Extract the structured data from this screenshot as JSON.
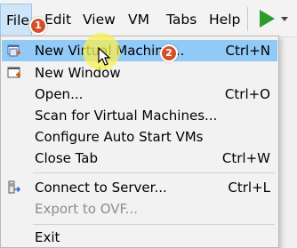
{
  "menubar": {
    "items": [
      "File",
      "Edit",
      "View",
      "VM",
      "Tabs",
      "Help"
    ]
  },
  "file_menu": {
    "new_vm": {
      "label": "New Virtual Machine...",
      "shortcut": "Ctrl+N"
    },
    "new_window": {
      "label": "New Window"
    },
    "open": {
      "label": "Open...",
      "shortcut": "Ctrl+O"
    },
    "scan": {
      "label": "Scan for Virtual Machines..."
    },
    "configure_autostart": {
      "label": "Configure Auto Start VMs"
    },
    "close_tab": {
      "label": "Close Tab",
      "shortcut": "Ctrl+W"
    },
    "connect_server": {
      "label": "Connect to Server...",
      "shortcut": "Ctrl+L"
    },
    "export_ovf": {
      "label": "Export to OVF..."
    },
    "exit": {
      "label": "Exit"
    }
  },
  "callouts": {
    "step1": "1",
    "step2": "2"
  },
  "colors": {
    "highlight": "#91c9f7",
    "badge": "#d4502c",
    "play": "#2e9b2e"
  }
}
